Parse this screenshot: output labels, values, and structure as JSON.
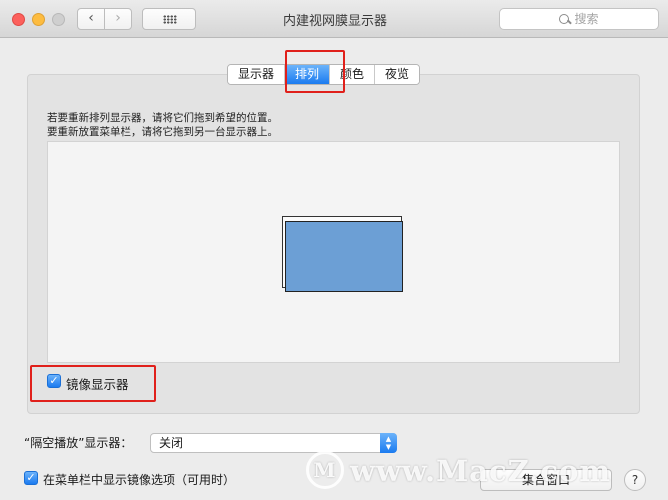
{
  "window": {
    "title": "内建视网膜显示器",
    "search_placeholder": "搜索"
  },
  "tabs": [
    {
      "label": "显示器",
      "active": false
    },
    {
      "label": "排列",
      "active": true
    },
    {
      "label": "颜色",
      "active": false
    },
    {
      "label": "夜览",
      "active": false
    }
  ],
  "arrangement": {
    "instruction_1": "若要重新排列显示器，请将它们拖到希望的位置。",
    "instruction_2": "要重新放置菜单栏，请将它拖到另一台显示器上。"
  },
  "mirror": {
    "label": "镜像显示器",
    "checked": true
  },
  "airplay": {
    "label": "“隔空播放”显示器：",
    "value": "关闭"
  },
  "menubar_option": {
    "label": "在菜单栏中显示镜像选项（可用时）",
    "checked": true
  },
  "buttons": {
    "gather": "集合窗口",
    "help": "?"
  },
  "watermark": "www.MacZ.com",
  "colors": {
    "accent": "#1b7bf0",
    "highlight": "#e0201b",
    "display_fill": "#6c9fd5"
  }
}
